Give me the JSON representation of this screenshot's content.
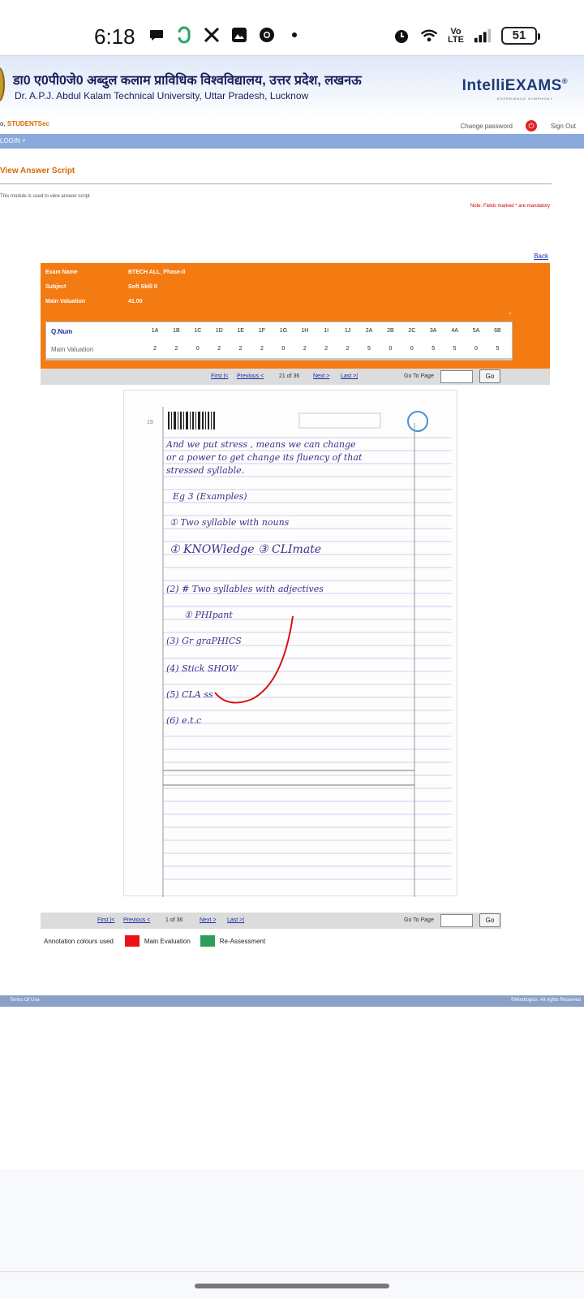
{
  "status_bar": {
    "time": "6:18",
    "left_icons": [
      "chat-bubble-icon",
      "g-app-icon",
      "x-icon",
      "image-icon",
      "chrome-icon",
      "dot-icon"
    ],
    "volte": "Vo\nLTE",
    "battery": "51"
  },
  "header": {
    "hindi_title": "डा0 ए0पी0जे0 अब्दुल कलाम प्राविधिक विश्वविद्यालय, उत्तर प्रदेश, लखनऊ",
    "english_title": "Dr. A.P.J. Abdul Kalam Technical University, Uttar Pradesh, Lucknow",
    "brand": "IntelliEXAMS",
    "brand_reg": "®",
    "brand_sub": "EXPERIENCE SYMPHONY"
  },
  "user_bar": {
    "prefix": "o,",
    "user": "STUDENTSec",
    "change_password": "Change password",
    "sign_out": "Sign Out"
  },
  "nav": {
    "login": "LOGIN ˅"
  },
  "page": {
    "title": "View Answer Script",
    "module_note": "This module is used to view answer script",
    "mandatory_note": "Note: Fields marked * are mandatory",
    "back": "Back"
  },
  "exam": {
    "labels": {
      "exam_name": "Exam Name",
      "subject": "Subject",
      "main_valuation": "Main Valuation"
    },
    "exam_name": "BTECH ALL_Phase-II",
    "subject": "Soft Skill II",
    "main_valuation": "41.00",
    "table": {
      "qnum_header": "Q.Num",
      "valuation_header": "Main Valuation",
      "questions": [
        "1A",
        "1B",
        "1C",
        "1D",
        "1E",
        "1F",
        "1G",
        "1H",
        "1I",
        "1J",
        "2A",
        "2B",
        "2C",
        "3A",
        "4A",
        "5A",
        "6B"
      ],
      "marks": [
        "2",
        "2",
        "0",
        "2",
        "2",
        "2",
        "0",
        "2",
        "2",
        "2",
        "5",
        "0",
        "0",
        "5",
        "5",
        "0",
        "5"
      ]
    }
  },
  "pager_top": {
    "first": "First |<",
    "previous": "Previous <",
    "status": "21 of 36",
    "next": "Next >",
    "last": "Last >|",
    "goto": "Go To Page",
    "go": "Go"
  },
  "pager_bottom": {
    "first": "First |<",
    "previous": "Previous <",
    "status": "1 of 36",
    "next": "Next >",
    "last": "Last >|",
    "goto": "Go To Page",
    "go": "Go"
  },
  "answer_sheet": {
    "page_number": "19",
    "lines": [
      "And we put stress , means we can change",
      "or a power to get change its fluency of that",
      "stressed syllable.",
      "Eg 3 (Examples)",
      "① Two syllable with nouns",
      "① KNOWledge   ③ CLImate",
      "(2) # Two syllables with adjectives",
      "① PHIpant",
      "(3)  Gr graPHICS",
      "(4)  Stick SHOW",
      "(5)  CLA ss",
      "(6)  e.t.c"
    ]
  },
  "legend": {
    "label": "Annotation colours used",
    "main": "Main Evaluation",
    "main_color": "#ee1111",
    "reassess": "Re-Assessment",
    "reassess_color": "#2e9c5a"
  },
  "footer": {
    "terms": "Terms Of Use",
    "copyright": "©Mindlogicx. All rights Reserved"
  }
}
